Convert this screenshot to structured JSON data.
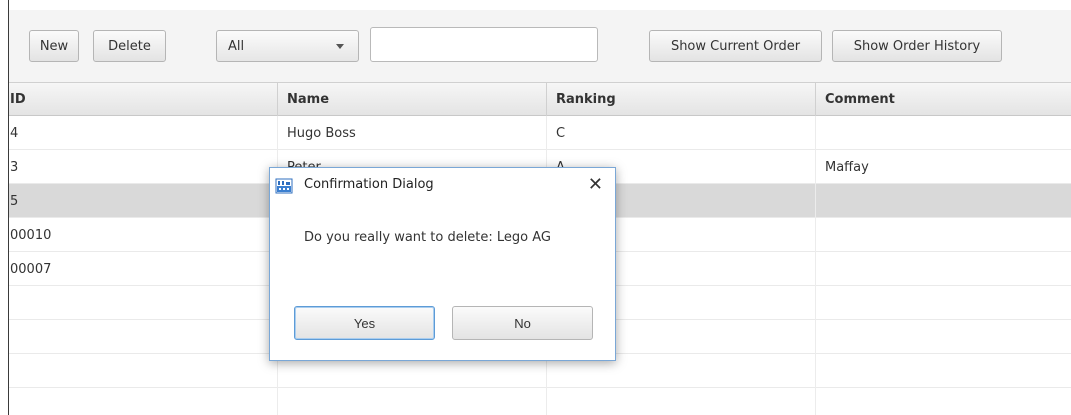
{
  "toolbar": {
    "new_label": "New",
    "delete_label": "Delete",
    "filter_value": "All",
    "search_value": "",
    "show_current_order_label": "Show Current Order",
    "show_order_history_label": "Show Order History"
  },
  "table": {
    "columns": [
      "ID",
      "Name",
      "Ranking",
      "Comment"
    ],
    "rows": [
      {
        "id": "4",
        "name": "Hugo Boss",
        "ranking": "C",
        "comment": ""
      },
      {
        "id": "3",
        "name": "Peter",
        "ranking": "A",
        "comment": "Maffay"
      },
      {
        "id": "5",
        "name": "",
        "ranking": "",
        "comment": ""
      },
      {
        "id": "00010",
        "name": "",
        "ranking": "",
        "comment": ""
      },
      {
        "id": "00007",
        "name": "",
        "ranking": "",
        "comment": ""
      },
      {
        "id": "",
        "name": "",
        "ranking": "",
        "comment": ""
      },
      {
        "id": "",
        "name": "",
        "ranking": "",
        "comment": ""
      },
      {
        "id": "",
        "name": "",
        "ranking": "",
        "comment": ""
      },
      {
        "id": "",
        "name": "",
        "ranking": "",
        "comment": ""
      }
    ],
    "selected_row": 2
  },
  "dialog": {
    "title": "Confirmation Dialog",
    "message": "Do you really want to delete: Lego AG",
    "yes_label": "Yes",
    "no_label": "No",
    "close_glyph": "✕"
  },
  "colors": {
    "selection": "#d9d9d9",
    "dialog_border": "#7aa7d6",
    "default_button_border": "#5d9bd6"
  }
}
